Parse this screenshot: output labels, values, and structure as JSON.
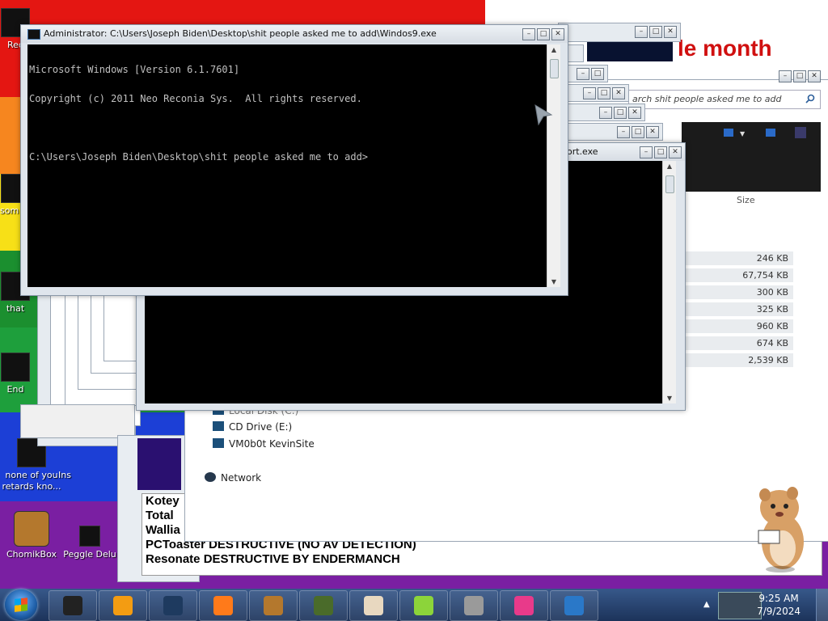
{
  "desktop": {
    "wallpaper_text": "le month",
    "icons": [
      {
        "label": "Rec",
        "icon": "recycle-bin-icon"
      },
      {
        "label": "som\nra",
        "icon": "file-icon"
      },
      {
        "label": "that",
        "icon": "file-icon"
      },
      {
        "label": "End",
        "icon": "file-icon"
      },
      {
        "label": "none of you retards kno...",
        "icon": "file-icon"
      },
      {
        "label": "Ins",
        "icon": "file-icon"
      },
      {
        "label": "ChomikBox",
        "icon": "chomikbox-icon"
      },
      {
        "label": "Peggle Delu",
        "icon": "peggle-icon"
      }
    ]
  },
  "cmd_window": {
    "title": "Administrator: C:\\Users\\Joseph Biden\\Desktop\\shit people asked me to add\\Windos9.exe",
    "lines": [
      "Microsoft Windows [Version 6.1.7601]",
      "Copyright (c) 2011 Neo Reconia Sys.  All rights reserved.",
      "",
      "C:\\Users\\Joseph Biden\\Desktop\\shit people asked me to add>"
    ]
  },
  "second_window": {
    "title": "ort.exe"
  },
  "explorer": {
    "search_text": "arch shit people asked me to add",
    "size_header": "Size",
    "sizes": [
      "246 KB",
      "67,754 KB",
      "300 KB",
      "325 KB",
      "960 KB",
      "674 KB",
      "2,539 KB"
    ],
    "tree": [
      {
        "label": "Local Disk (C:)",
        "icon": "hard-drive-icon"
      },
      {
        "label": "CD Drive (E:)",
        "icon": "cd-drive-icon"
      },
      {
        "label": "VM0b0t KevinSite",
        "icon": "network-drive-icon"
      },
      {
        "label": "Network",
        "icon": "network-icon"
      }
    ]
  },
  "bold_list": {
    "rows": [
      "Kotey",
      "Total",
      "Wallia",
      "PCToaster DESTRUCTIVE (NO AV DETECTION)",
      "Resonate DESTRUCTIVE BY ENDERMANCH"
    ]
  },
  "taskbar": {
    "items": [
      {
        "icon": "cmd-icon",
        "color": "#222222"
      },
      {
        "icon": "media-player-icon",
        "color": "#f39c12"
      },
      {
        "icon": "globe-icon",
        "color": "#1e3a5f"
      },
      {
        "icon": "firefox-icon",
        "color": "#ff7a1a"
      },
      {
        "icon": "chomikbox-icon",
        "color": "#b4782d"
      },
      {
        "icon": "minecraft-icon",
        "color": "#4a6b2a"
      },
      {
        "icon": "doctor-icon",
        "color": "#e8d8c0"
      },
      {
        "icon": "lime-icon",
        "color": "#8cd43a"
      },
      {
        "icon": "skull-icon",
        "color": "#9a9a9a"
      },
      {
        "icon": "pink-app-icon",
        "color": "#e83a8a"
      },
      {
        "icon": "monitor-icon",
        "color": "#2a78c8"
      }
    ],
    "time": "9:25 AM",
    "date": "7/9/2024"
  }
}
